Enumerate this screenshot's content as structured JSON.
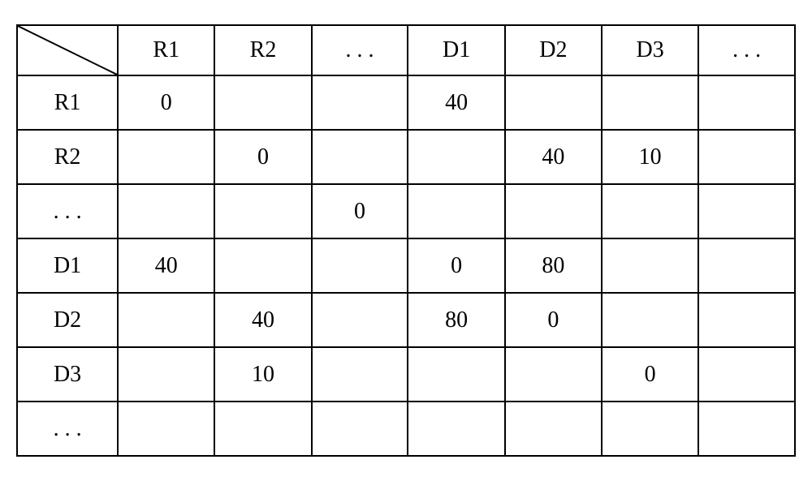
{
  "chart_data": {
    "type": "table",
    "title": "",
    "column_headers": [
      "R1",
      "R2",
      ". . .",
      "D1",
      "D2",
      "D3",
      ". . ."
    ],
    "row_headers": [
      "R1",
      "R2",
      ". . .",
      "D1",
      "D2",
      "D3",
      ". . ."
    ],
    "matrix": [
      [
        "0",
        "",
        "",
        "40",
        "",
        "",
        ""
      ],
      [
        "",
        "0",
        "",
        "",
        "40",
        "10",
        ""
      ],
      [
        "",
        "",
        "0",
        "",
        "",
        "",
        ""
      ],
      [
        "40",
        "",
        "",
        "0",
        "80",
        "",
        ""
      ],
      [
        "",
        "40",
        "",
        "80",
        "0",
        "",
        ""
      ],
      [
        "",
        "10",
        "",
        "",
        "",
        "0",
        ""
      ],
      [
        "",
        "",
        "",
        "",
        "",
        "",
        ""
      ]
    ]
  },
  "headers": {
    "col1": "R1",
    "col2": "R2",
    "col3": ". . .",
    "col4": "D1",
    "col5": "D2",
    "col6": "D3",
    "col7": ". . ."
  },
  "rows": {
    "r1": {
      "label": "R1",
      "c1": "0",
      "c2": "",
      "c3": "",
      "c4": "40",
      "c5": "",
      "c6": "",
      "c7": ""
    },
    "r2": {
      "label": "R2",
      "c1": "",
      "c2": "0",
      "c3": "",
      "c4": "",
      "c5": "40",
      "c6": "10",
      "c7": ""
    },
    "r3": {
      "label": ". . .",
      "c1": "",
      "c2": "",
      "c3": "0",
      "c4": "",
      "c5": "",
      "c6": "",
      "c7": ""
    },
    "r4": {
      "label": "D1",
      "c1": "40",
      "c2": "",
      "c3": "",
      "c4": "0",
      "c5": "80",
      "c6": "",
      "c7": ""
    },
    "r5": {
      "label": "D2",
      "c1": "",
      "c2": "40",
      "c3": "",
      "c4": "80",
      "c5": "0",
      "c6": "",
      "c7": ""
    },
    "r6": {
      "label": "D3",
      "c1": "",
      "c2": "10",
      "c3": "",
      "c4": "",
      "c5": "",
      "c6": "0",
      "c7": ""
    },
    "r7": {
      "label": ". . .",
      "c1": "",
      "c2": "",
      "c3": "",
      "c4": "",
      "c5": "",
      "c6": "",
      "c7": ""
    }
  }
}
